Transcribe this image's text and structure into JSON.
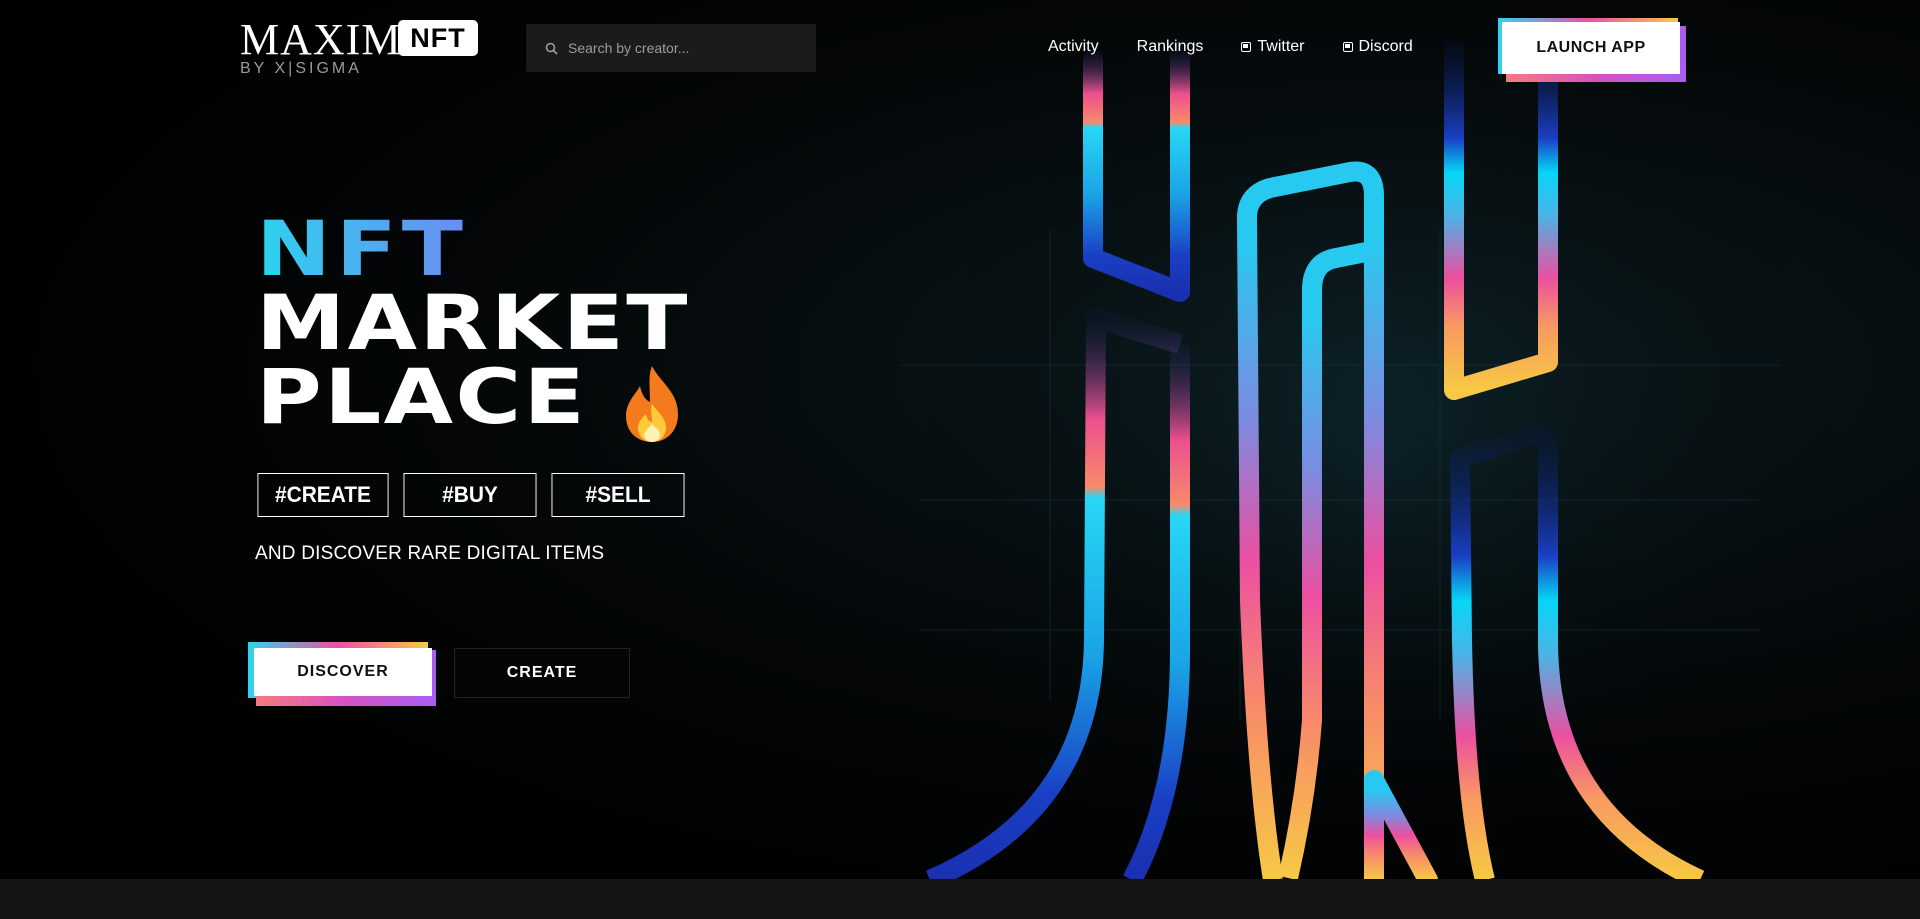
{
  "header": {
    "logo": {
      "brand": "MAXIM",
      "badge": "NFT",
      "subline": "BY X|SIGMA"
    },
    "search": {
      "placeholder": "Search by creator...",
      "icon": "search-icon"
    },
    "nav": [
      {
        "label": "Activity",
        "icon": null
      },
      {
        "label": "Rankings",
        "icon": null
      },
      {
        "label": "Twitter",
        "icon": "twitter-icon"
      },
      {
        "label": "Discord",
        "icon": "discord-icon"
      }
    ],
    "launch_button": "LAUNCH APP"
  },
  "hero": {
    "title_line1": "NFT",
    "title_line2": "MARKET",
    "title_line3": "PLACE",
    "emoji_icon": "fire-icon",
    "tags": [
      "#CREATE",
      "#BUY",
      "#SELL"
    ],
    "tagline": "AND DISCOVER RARE DIGITAL ITEMS",
    "discover_button": "DISCOVER",
    "create_button": "CREATE"
  },
  "colors": {
    "gradient_cyan": "#2fd4f0",
    "gradient_pink": "#ec4fa5",
    "gradient_purple": "#a95cf2",
    "gradient_yellow": "#f7c944",
    "gradient_blue": "#1a3fc4"
  }
}
